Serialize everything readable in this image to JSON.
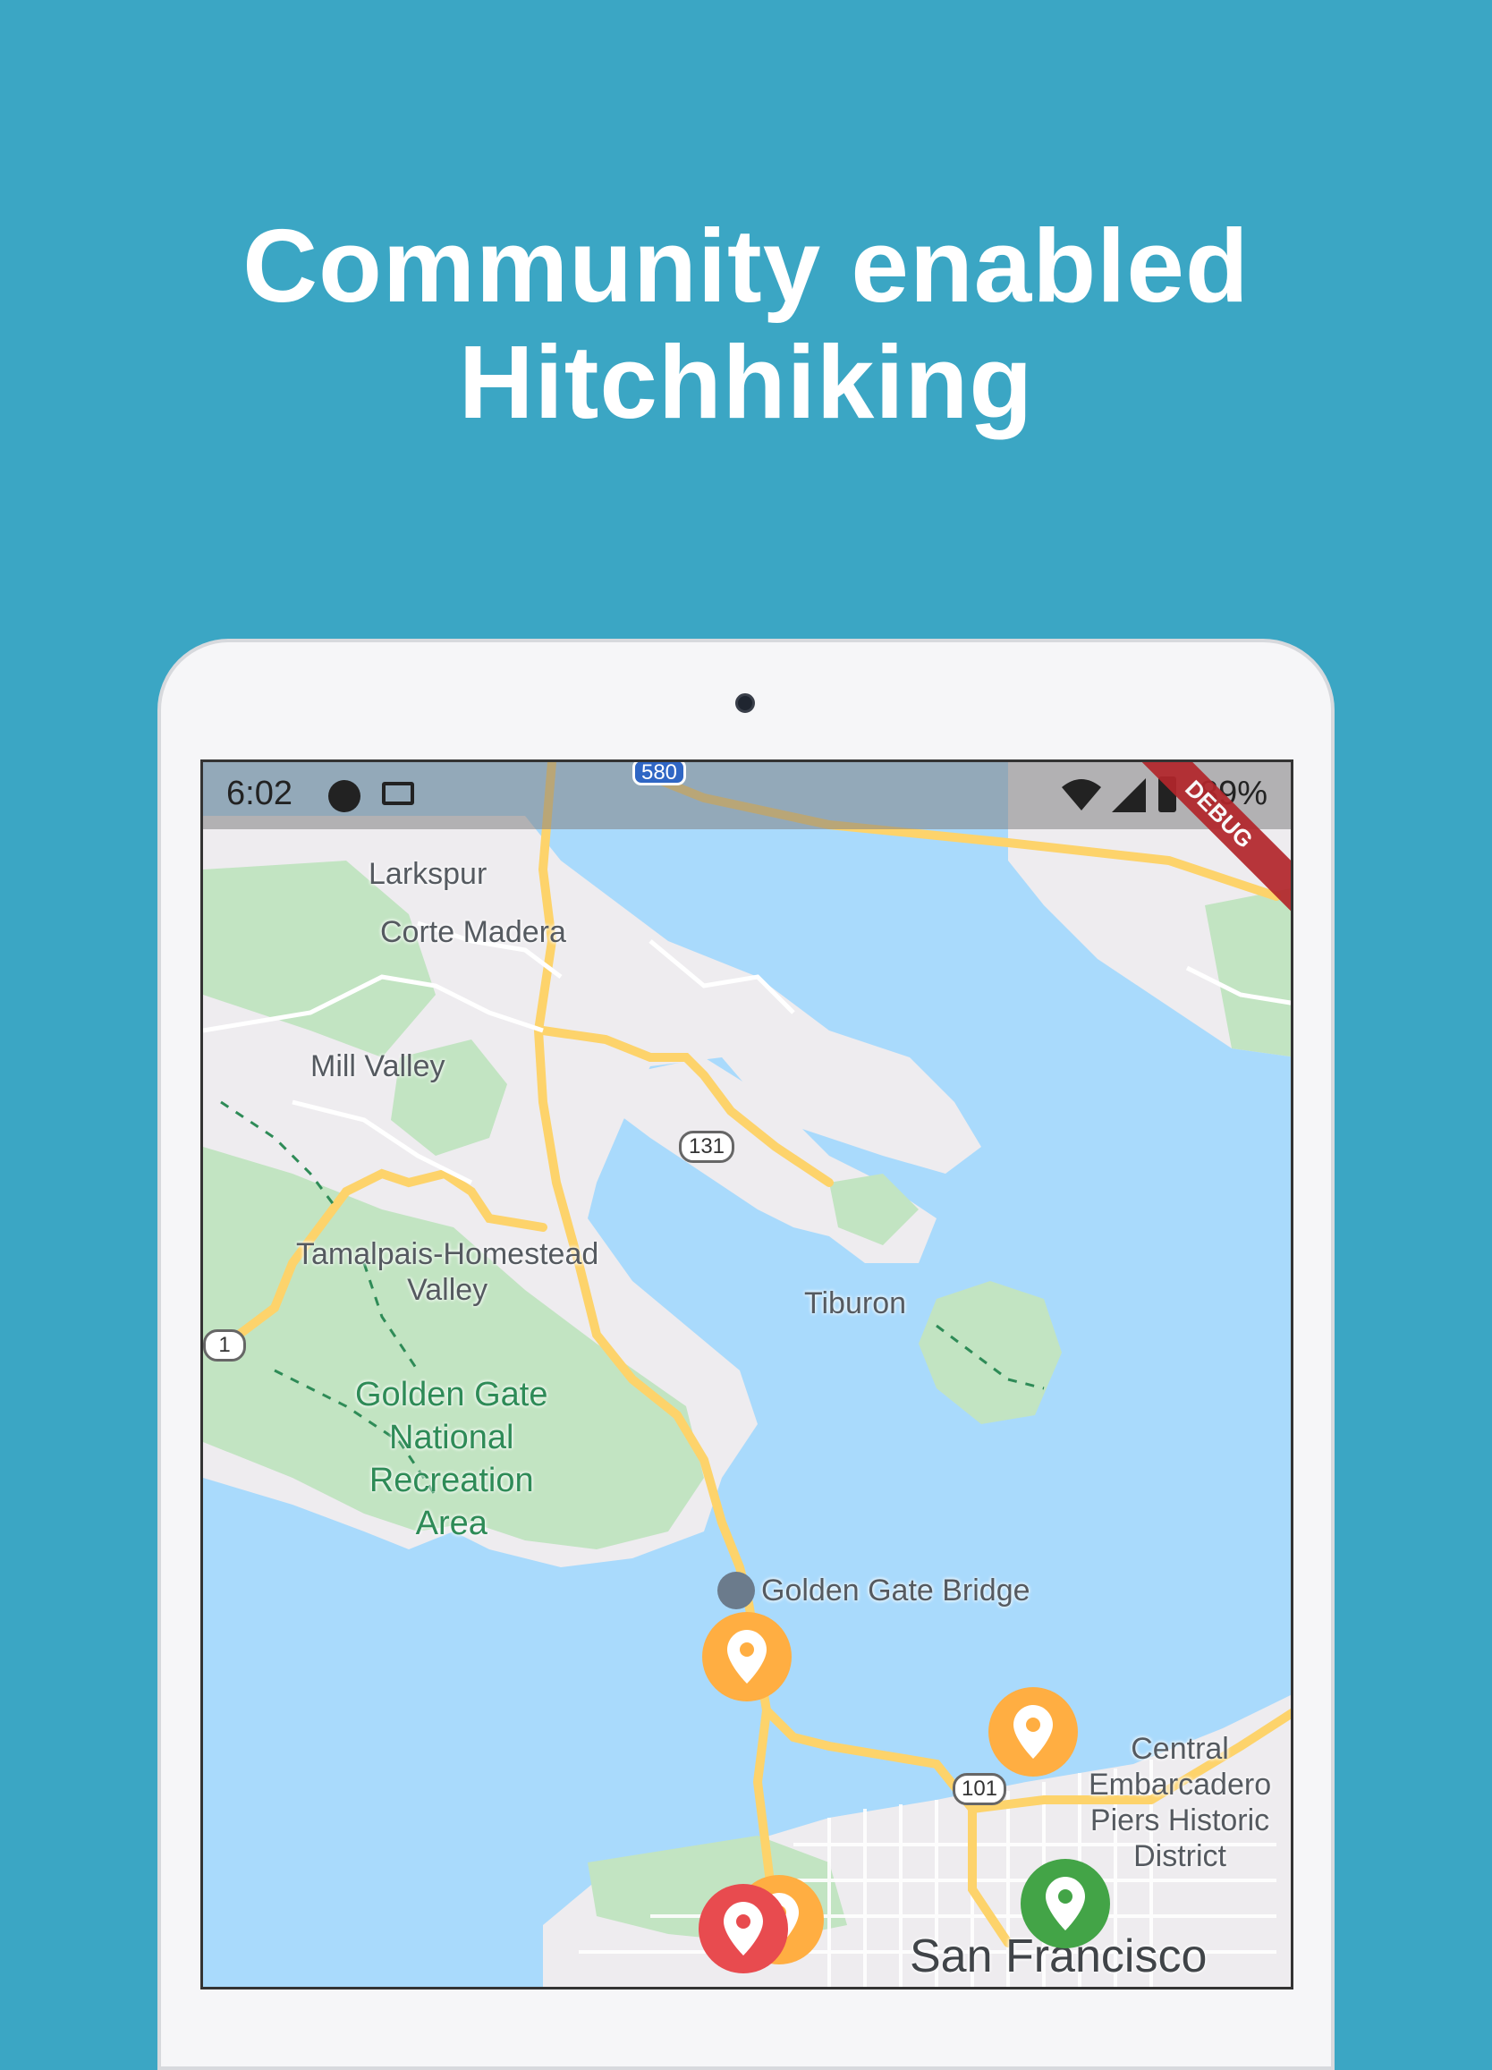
{
  "headline": {
    "line1": "Community enabled",
    "line2": "Hitchhiking"
  },
  "status_bar": {
    "time": "6:02",
    "battery": "89%",
    "debug": "DEBUG"
  },
  "map": {
    "labels": {
      "larkspur": "Larkspur",
      "corte_madera": "Corte Madera",
      "mill_valley": "Mill Valley",
      "tamalpais": "Tamalpais-Homestead",
      "tamalpais2": "Valley",
      "tiburon": "Tiburon",
      "gg_nra_1": "Golden Gate",
      "gg_nra_2": "National",
      "gg_nra_3": "Recreation",
      "gg_nra_4": "Area",
      "gg_bridge": "Golden Gate Bridge",
      "central_1": "Central",
      "central_2": "Embarcadero",
      "central_3": "Piers Historic",
      "central_4": "District",
      "san_francisco": "San Francisco"
    },
    "shields": {
      "r580": "580",
      "r131": "131",
      "r1": "1",
      "r101": "101"
    },
    "colors": {
      "water": "#a9dafc",
      "land": "#eeecef",
      "park": "#c2e4c2",
      "highway": "#fdd36b"
    },
    "pins": [
      {
        "name": "pin-orange",
        "color": "#ffae42"
      },
      {
        "name": "pin-orange",
        "color": "#ffae42"
      },
      {
        "name": "pin-green",
        "color": "#43a447"
      },
      {
        "name": "pin-red",
        "color": "#e84b4f"
      }
    ]
  }
}
